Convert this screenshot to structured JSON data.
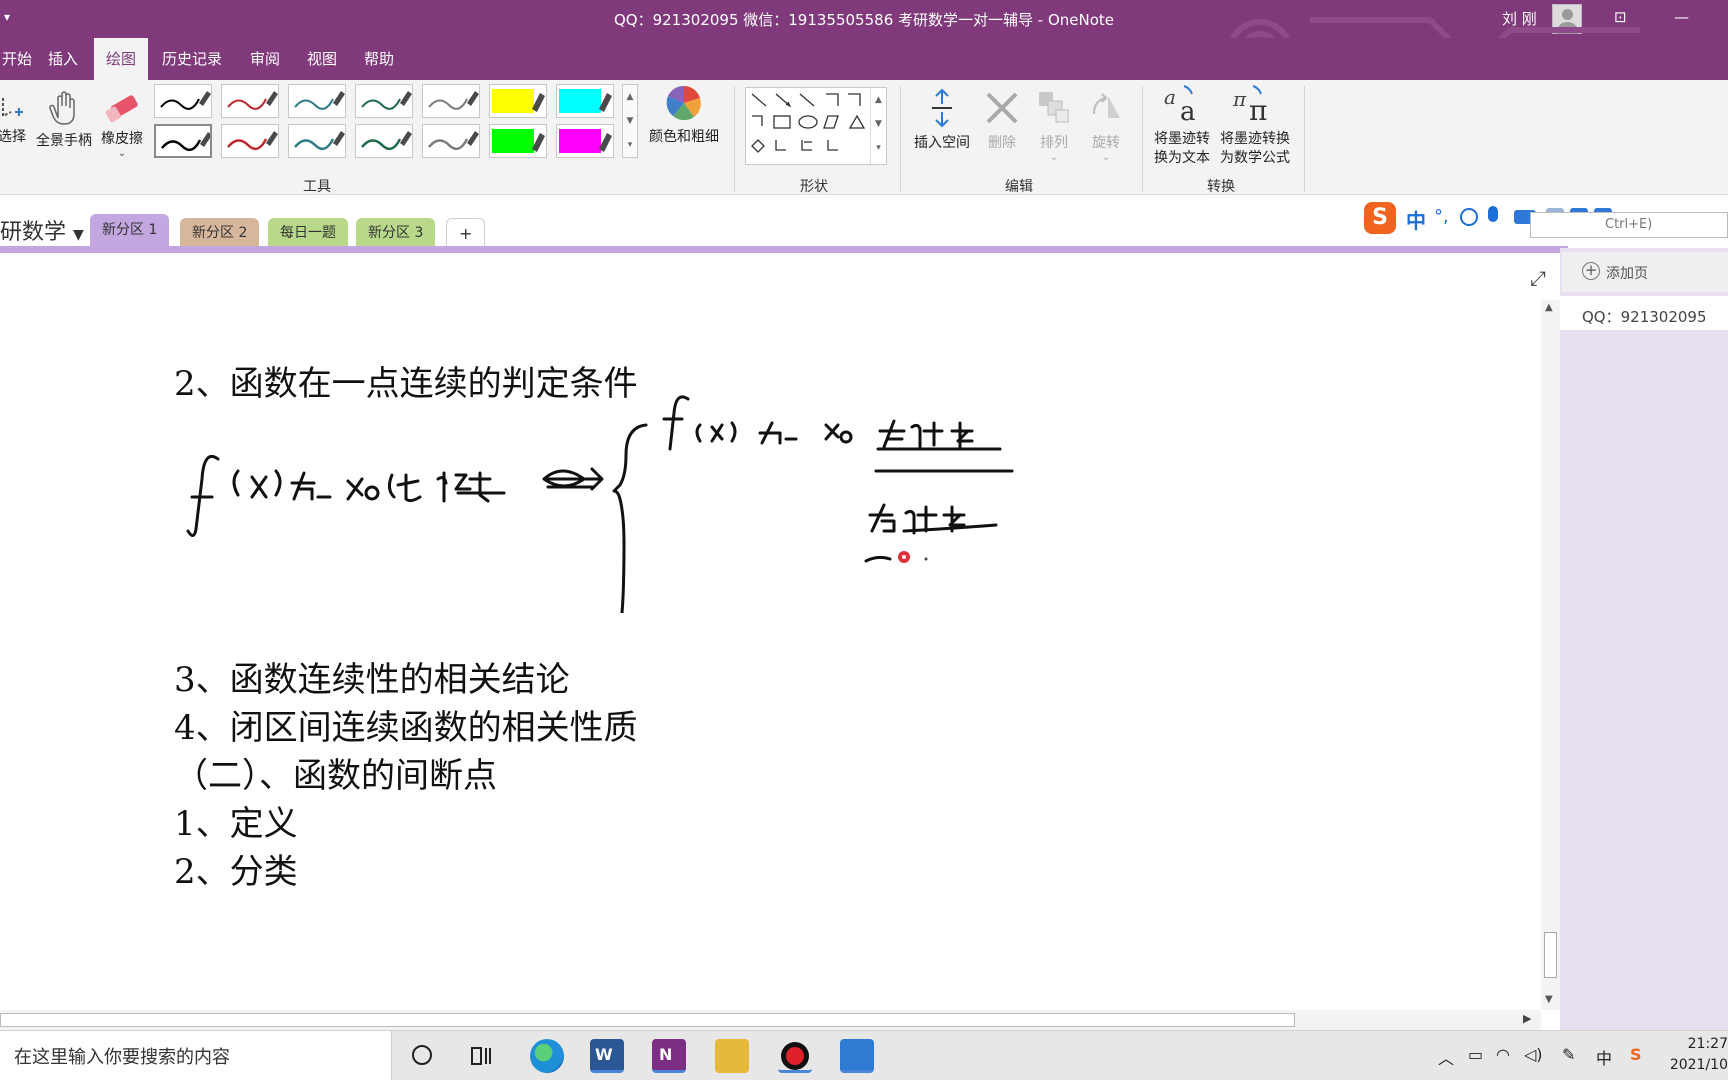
{
  "window": {
    "quick_access": "▾",
    "title": "QQ：921302095     微信：19135505586    考研数学一对一辅导  -  OneNote",
    "user": "刘 刚",
    "restore_glyph": "⊡",
    "minimize_glyph": "—"
  },
  "tabs": [
    "开始",
    "插入",
    "绘图",
    "历史记录",
    "审阅",
    "视图",
    "帮助"
  ],
  "active_tab": "绘图",
  "ribbon": {
    "select": "选择",
    "pan": "全景手柄",
    "eraser": "橡皮擦",
    "color_thickness": "颜色和粗细",
    "group_tools": "工具",
    "group_shapes": "形状",
    "insert_space": "插入空间",
    "delete": "删除",
    "arrange": "排列",
    "rotate": "旋转",
    "group_edit": "编辑",
    "ink_to_text_1": "将墨迹转",
    "ink_to_text_2": "换为文本",
    "ink_to_math_1": "将墨迹转换",
    "ink_to_math_2": "为数学公式",
    "group_convert": "转换"
  },
  "pen_colors": [
    "#000000",
    "#c0262d",
    "#2f7a86",
    "#1e6b4a",
    "#7b7b7b",
    "#ffff00",
    "#00ffff",
    "#000000",
    "#c0262d",
    "#2f7a86",
    "#1e6b4a",
    "#7b7b7b",
    "#00ff00",
    "#ff00ff"
  ],
  "notebook": "研数学",
  "sections": [
    {
      "label": "新分区 1",
      "color": "#c4a7e0"
    },
    {
      "label": "新分区 2",
      "color": "#d7b79b"
    },
    {
      "label": "每日一题",
      "color": "#b9d98a"
    },
    {
      "label": "新分区 3",
      "color": "#b9d98a"
    }
  ],
  "add_section": "+",
  "ime": {
    "s": "S",
    "lang": "中"
  },
  "search_hint": "Ctrl+E)",
  "page_list": {
    "add_page": "添加页",
    "pages": [
      "QQ：921302095"
    ]
  },
  "notes": {
    "line1": "2、函数在一点连续的判定条件",
    "line2": "3、函数连续性的相关结论",
    "line3": "4、闭区间连续函数的相关性质",
    "line4": "（二）、函数的间断点",
    "line5": "1、定义",
    "line6": "2、分类"
  },
  "taskbar": {
    "search_placeholder": "在这里输入你要搜索的内容",
    "time": "21:27",
    "date": "2021/10",
    "ime_lang": "中"
  }
}
